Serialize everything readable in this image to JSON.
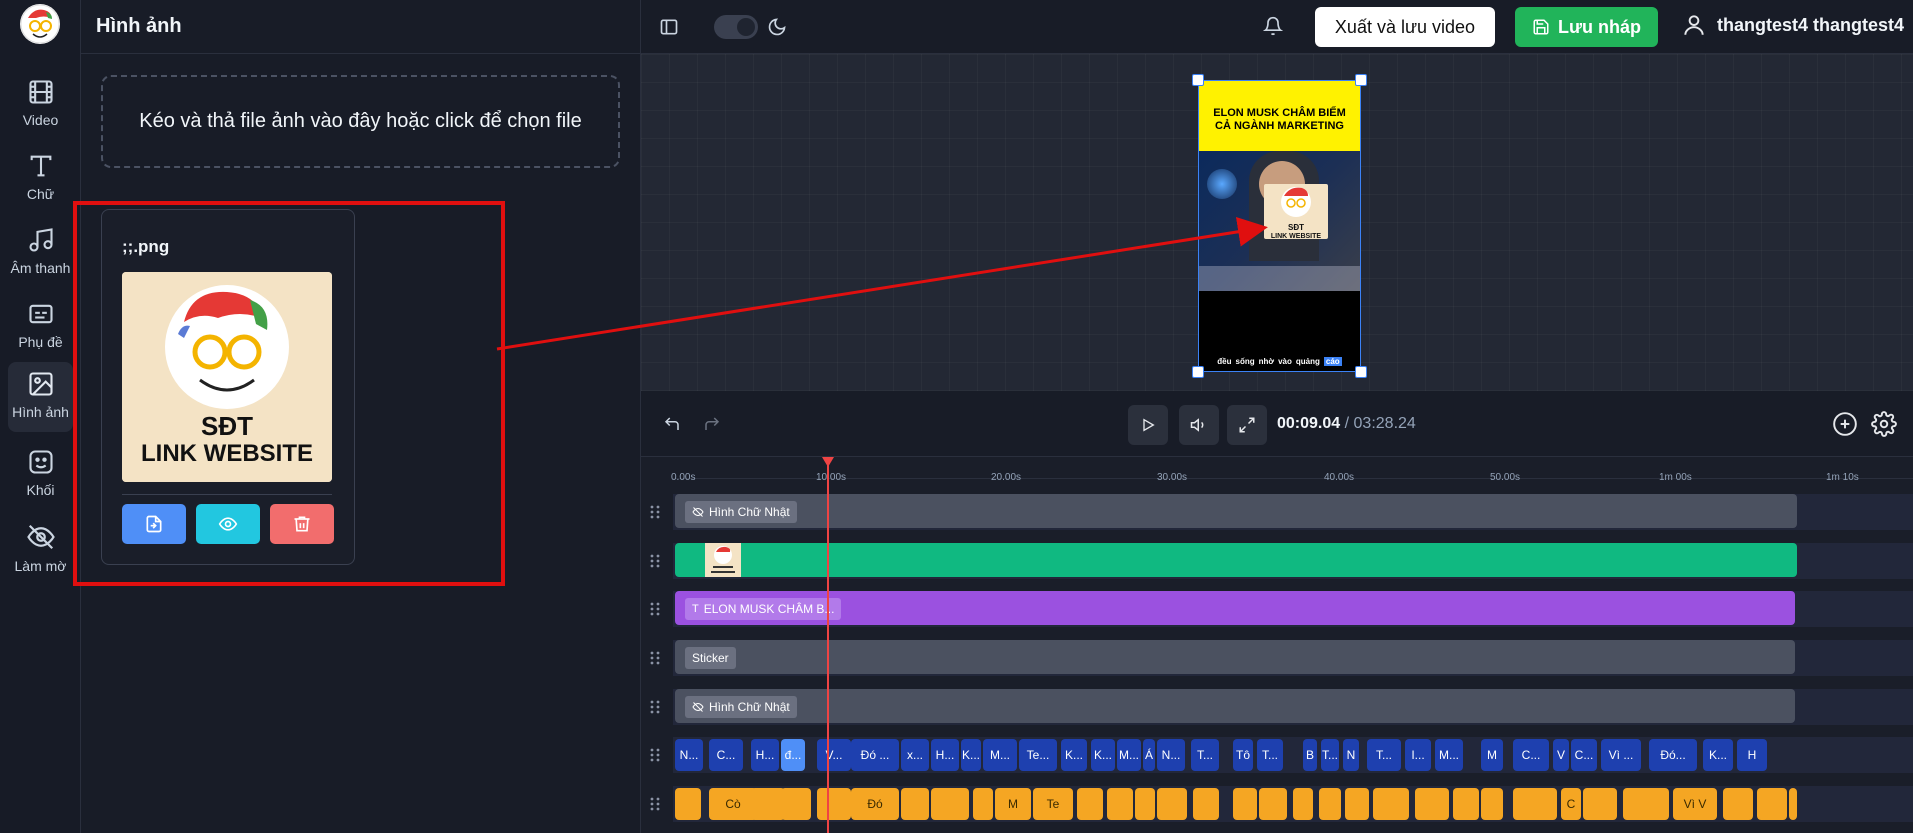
{
  "sidebar": {
    "items": [
      {
        "label": "Video",
        "icon": "film-icon"
      },
      {
        "label": "Chữ",
        "icon": "text-icon"
      },
      {
        "label": "Âm thanh",
        "icon": "music-icon"
      },
      {
        "label": "Phụ đề",
        "icon": "subtitles-icon"
      },
      {
        "label": "Hình ảnh",
        "icon": "image-icon"
      },
      {
        "label": "Khối",
        "icon": "shapes-icon"
      },
      {
        "label": "Làm mờ",
        "icon": "eye-off-icon"
      }
    ],
    "active": "Hình ảnh"
  },
  "panel": {
    "title": "Hình ảnh",
    "dropzone_text": "Kéo và thả file ảnh vào đây hoặc click để chọn file",
    "card": {
      "filename": ";;.png",
      "thumb_line1": "SĐT",
      "thumb_line2": "LINK WEBSITE"
    }
  },
  "topbar": {
    "export_label": "Xuất và lưu video",
    "save_label": "Lưu nháp",
    "username": "thangtest4 thangtest4"
  },
  "preview": {
    "banner_line1": "ELON MUSK CHÂM BIẾM",
    "banner_line2": "CẢ NGÀNH MARKETING",
    "overlay_line1": "SĐT",
    "overlay_line2": "LINK WEBSITE",
    "subtitle_words": [
      "đều",
      "sống",
      "nhờ",
      "vào",
      "quảng",
      "cáo"
    ]
  },
  "player": {
    "current_time": "00:09.04",
    "separator": "/",
    "total_time": "03:28.24"
  },
  "timeline": {
    "ruler_labels": [
      "0.00s",
      "10.00s",
      "20.00s",
      "30.00s",
      "40.00s",
      "50.00s",
      "1m 00s",
      "1m 10s"
    ],
    "tracks": [
      {
        "label": "Hình Chữ Nhật",
        "type": "shape"
      },
      {
        "label": "",
        "type": "image"
      },
      {
        "label": "ELON MUSK CHÂM B...",
        "type": "text"
      },
      {
        "label": "Sticker",
        "type": "sticker"
      },
      {
        "label": "Hình Chữ Nhật",
        "type": "shape"
      }
    ],
    "subtitle_clips": [
      "N...",
      "C...",
      "H...",
      "đ...",
      "V...",
      "Đó ...",
      "x...",
      "H...",
      "K...",
      "M...",
      "Te...",
      "K...",
      "K...",
      "M...",
      "Á",
      "N...",
      "T...",
      "Tô",
      "T...",
      "B",
      "T...",
      "N",
      "T...",
      "I...",
      "M...",
      "M",
      "C...",
      "V",
      "C...",
      "Vì ...",
      "Đó...",
      "K...",
      "H"
    ],
    "audio_clips": [
      "",
      "Cò",
      "",
      "",
      "",
      "Đó",
      "",
      "",
      "",
      "M",
      "Te",
      "",
      "",
      "",
      "",
      "",
      "",
      "",
      "",
      "",
      "",
      "",
      "",
      "",
      "",
      "",
      "C",
      "",
      "",
      "Vì V",
      "",
      "",
      ""
    ]
  },
  "colors": {
    "accent_green": "#21b45a",
    "highlight_red": "#e00f0f",
    "track_green": "#10b981",
    "track_purple": "#9b51e0",
    "subtitle_blue": "#1e40af",
    "audio_orange": "#f5a623"
  }
}
